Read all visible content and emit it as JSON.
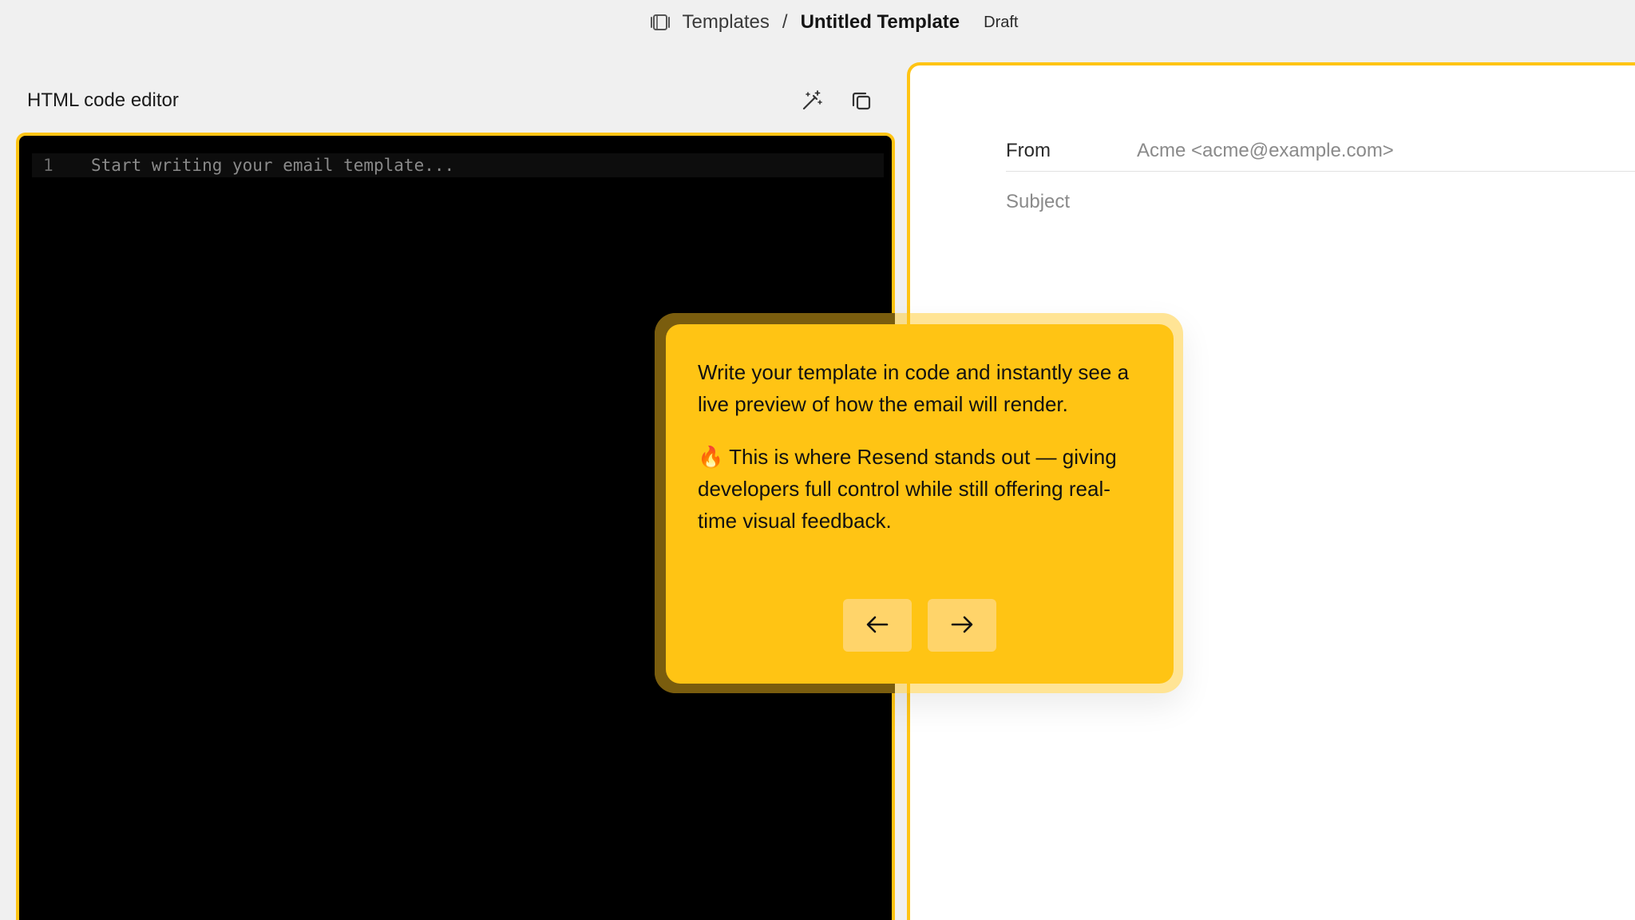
{
  "header": {
    "crumb_icon": "template-icon",
    "templates_label": "Templates",
    "separator": "/",
    "current_label": "Untitled Template",
    "status_badge": "Draft"
  },
  "editor": {
    "title": "HTML code editor",
    "tools": [
      {
        "name": "magic-wand-icon"
      },
      {
        "name": "copy-icon"
      }
    ],
    "lines": [
      {
        "number": "1",
        "placeholder": "Start writing your email template..."
      }
    ]
  },
  "preview": {
    "from_label": "From",
    "from_value": "Acme <acme@example.com>",
    "subject_label": "Subject"
  },
  "tour": {
    "paragraph_1": "Write your template in code and instantly see a live preview of how the email will render.",
    "paragraph_2_emoji": "🔥",
    "paragraph_2": " This is where Resend stands out — giving developers full control while still offering real-time visual feedback.",
    "prev_icon": "arrow-left-icon",
    "next_icon": "arrow-right-icon"
  },
  "colors": {
    "accent": "#ffc414",
    "editor_bg": "#000000",
    "page_bg": "#f0f0f0"
  }
}
